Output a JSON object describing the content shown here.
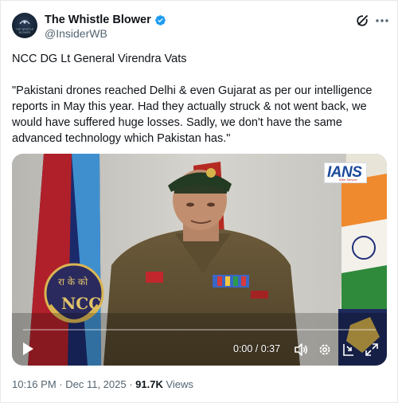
{
  "author": {
    "display_name": "The Whistle Blower",
    "handle": "@InsiderWB",
    "verified": true,
    "avatar_text": "THE WHISTLE BLOWER"
  },
  "post": {
    "line1": "NCC DG Lt General Virendra Vats",
    "quote_lines": [
      "\"Pakistani drones reached Delhi & even Gujarat as per our intelligence",
      "reports in May this year. Had they actually struck & not went back, we",
      "would have suffered huge losses. Sadly, we don't have the same",
      "advanced technology which Pakistan has.\""
    ]
  },
  "video": {
    "watermark_brand": "IANS",
    "watermark_sub": "Wire Service",
    "flag_text_hindi": "रा के को",
    "flag_text_ncc": "NCC",
    "time_display": "0:00 / 0:37",
    "progress": 0.0
  },
  "meta": {
    "time": "10:16 PM",
    "separator": " · ",
    "date": "Dec 11, 2025",
    "views_count": "91.7K",
    "views_label": " Views"
  },
  "colors": {
    "verified": "#1d9bf0",
    "text_primary": "#0f1419",
    "text_secondary": "#536471"
  },
  "icons": [
    "grok-icon",
    "more-icon",
    "play-icon",
    "volume-icon",
    "settings-icon",
    "pip-icon",
    "fullscreen-icon",
    "verified-badge-icon"
  ]
}
